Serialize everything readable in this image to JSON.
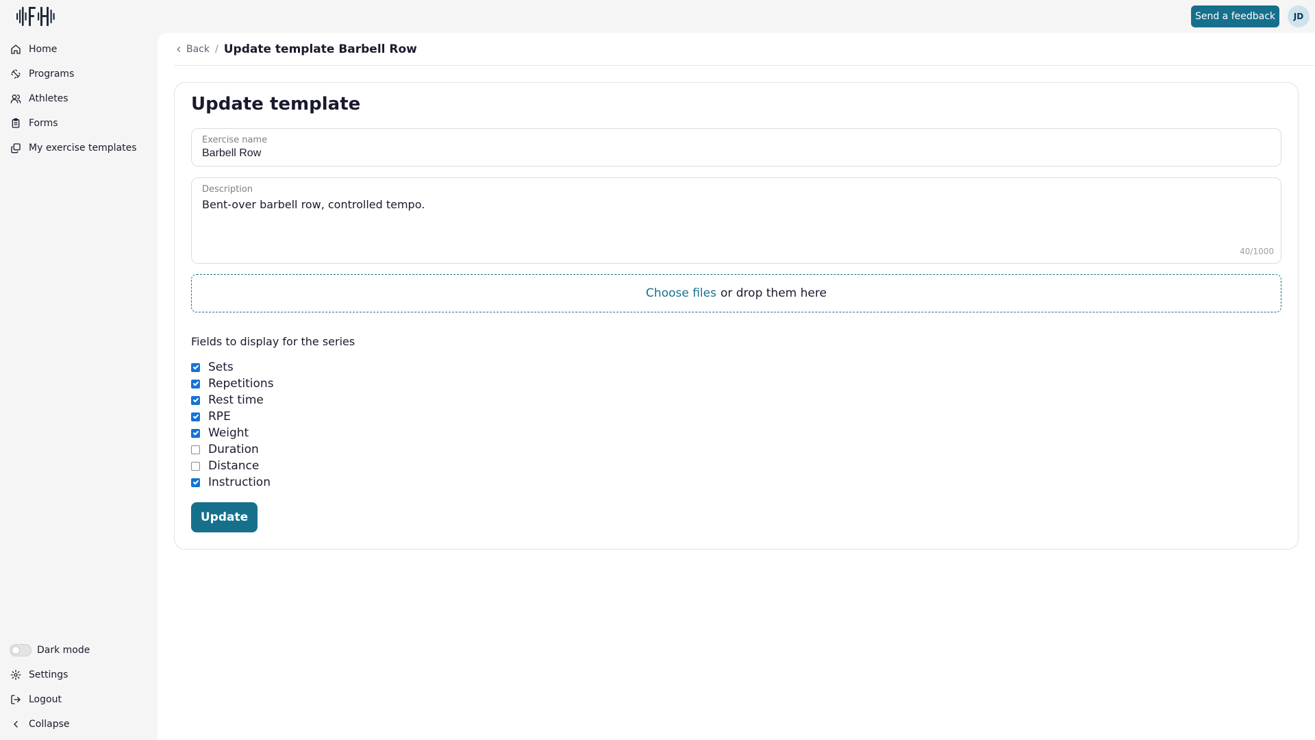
{
  "header": {
    "feedback_label": "Send a feedback",
    "avatar_initials": "JD"
  },
  "sidebar": {
    "items": [
      {
        "label": "Home",
        "icon": "home-icon"
      },
      {
        "label": "Programs",
        "icon": "dumbbell-icon"
      },
      {
        "label": "Athletes",
        "icon": "users-icon"
      },
      {
        "label": "Forms",
        "icon": "clipboard-icon"
      },
      {
        "label": "My exercise templates",
        "icon": "copy-icon"
      }
    ],
    "bottom": {
      "dark_mode_label": "Dark mode",
      "dark_mode_on": false,
      "settings_label": "Settings",
      "logout_label": "Logout",
      "collapse_label": "Collapse"
    }
  },
  "breadcrumb": {
    "back_label": "Back",
    "separator": "/",
    "title": "Update template Barbell Row"
  },
  "form": {
    "title": "Update template",
    "exercise_name_label": "Exercise name",
    "exercise_name_value": "Barbell Row",
    "description_label": "Description",
    "description_value": "Bent-over barbell row, controlled tempo.",
    "description_counter": "40/1000",
    "dropzone_link": "Choose files",
    "dropzone_text": "or drop them here",
    "fields_heading": "Fields to display for the series",
    "fields": [
      {
        "label": "Sets",
        "checked": true
      },
      {
        "label": "Repetitions",
        "checked": true
      },
      {
        "label": "Rest time",
        "checked": true
      },
      {
        "label": "RPE",
        "checked": true
      },
      {
        "label": "Weight",
        "checked": true
      },
      {
        "label": "Duration",
        "checked": false
      },
      {
        "label": "Distance",
        "checked": false
      },
      {
        "label": "Instruction",
        "checked": true
      }
    ],
    "submit_label": "Update"
  },
  "colors": {
    "accent": "#16708c",
    "checkbox": "#1672d6",
    "background": "#f5f5f5"
  }
}
